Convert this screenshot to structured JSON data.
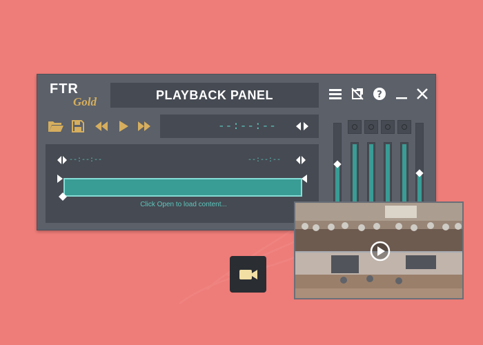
{
  "background_color": "#ee7c78",
  "panel": {
    "logo": {
      "primary": "FTR",
      "secondary": "Gold"
    },
    "title": "PLAYBACK PANEL",
    "top_icons": [
      "menu-icon",
      "detach-window-icon",
      "help-icon",
      "minimize-icon",
      "close-icon"
    ],
    "toolbar_icons": [
      "open-folder-icon",
      "save-icon",
      "rewind-icon",
      "play-icon",
      "fast-forward-icon"
    ],
    "time_display": "--:--:--",
    "timeline": {
      "start_time": "--:--:--",
      "end_time": "--:--:--",
      "hint": "Click Open to load content..."
    },
    "mixer": {
      "master_level": 0.5,
      "channel_levels": [
        1.0,
        1.0,
        1.0,
        1.0,
        1.0
      ],
      "output_level": 0.38
    }
  },
  "colors": {
    "panel_bg": "#5b6069",
    "dark_box": "#464a52",
    "accent_teal": "#399c95",
    "teal_text": "#5cc7be",
    "icon_gold": "#d6ae5e",
    "logo_gold": "#d6ae5e"
  },
  "video_thumbnail": {
    "icon": "play-circle-icon"
  },
  "camera_button": {
    "icon": "video-camera-icon"
  }
}
